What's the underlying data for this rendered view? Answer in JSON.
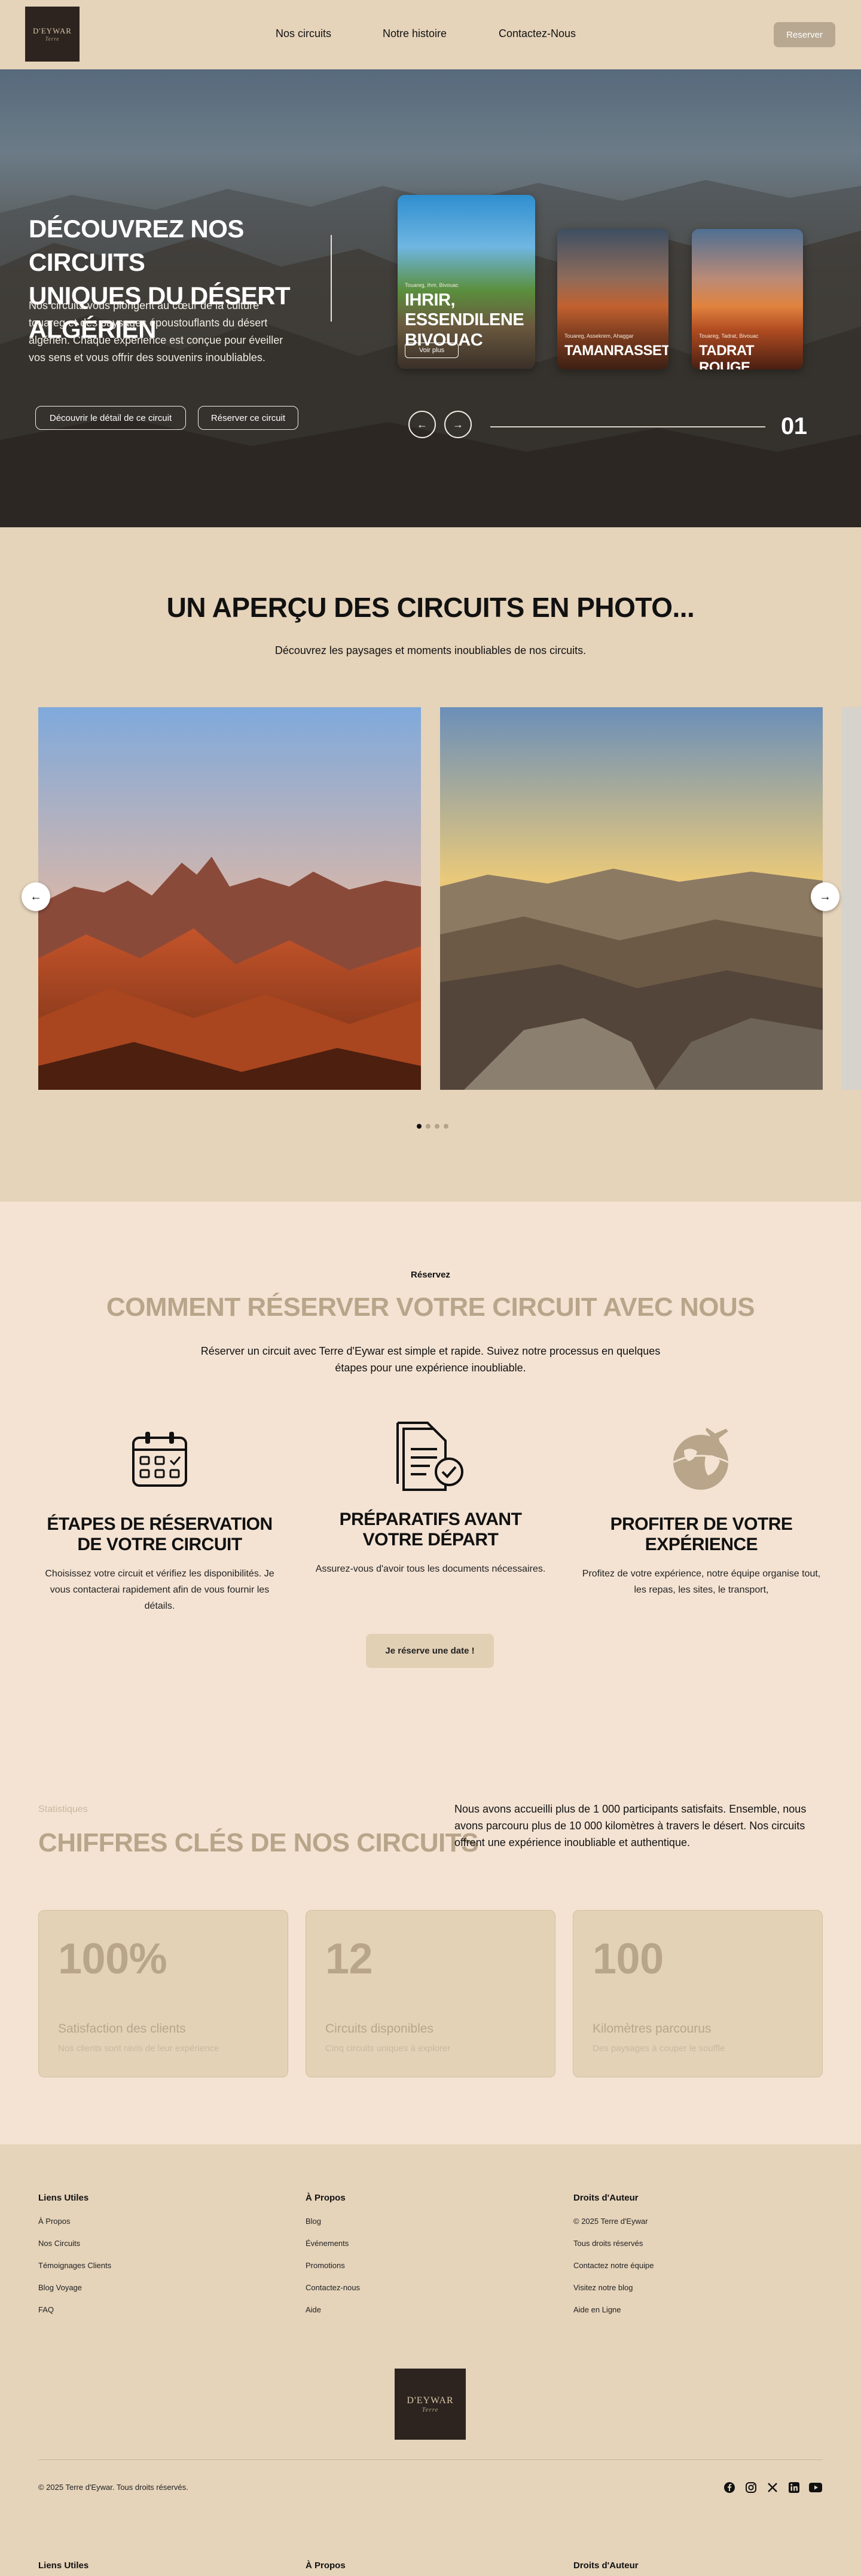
{
  "header": {
    "logo_text": "D'EYWAR",
    "logo_sub": "Terre",
    "nav": [
      "Nos circuits",
      "Notre histoire",
      "Contactez-Nous"
    ],
    "reserve_label": "Reserver"
  },
  "hero": {
    "title_line1": "DÉCOUVREZ NOS CIRCUITS",
    "title_line2": "UNIQUES DU DÉSERT ALGÉRIEN",
    "text": "Nos circuits vous plongent au cœur de la culture touareg et des paysages époustouflants du désert algérien. Chaque expérience est conçue pour éveiller vos sens et vous offrir des souvenirs inoubliables.",
    "btn_details": "Découvrir le détail de ce circuit",
    "btn_reserve": "Réserver ce circuit",
    "cards": [
      {
        "tag": "Touareg, Ihrir, Bivouac",
        "title_line1": "IHRIR, ESSENDILENE",
        "title_line2": "BIVOUAC",
        "button": "Voir plus"
      },
      {
        "tag": "Touareg, Assekrem, Ahaggar",
        "title_line1": "TAMANRASSET",
        "title_line2": ""
      },
      {
        "tag": "Touareg, Tadrat, Bivouac",
        "title_line1": "TADRAT ROUGE",
        "title_line2": ""
      }
    ],
    "slide_number": "01"
  },
  "gallery": {
    "title": "UN APERÇU DES CIRCUITS EN PHOTO...",
    "subtitle": "Découvrez les paysages et moments inoubliables de nos circuits.",
    "dots": 4,
    "active_dot": 0
  },
  "reserve": {
    "kicker": "Réservez",
    "title": "COMMENT RÉSERVER VOTRE CIRCUIT AVEC NOUS",
    "text_line1": "Réserver un circuit avec Terre d'Eywar est simple et rapide. Suivez notre processus en quelques",
    "text_line2": "étapes pour une expérience inoubliable.",
    "steps": [
      {
        "icon": "calendar-icon",
        "title": "ÉTAPES DE RÉSERVATION DE VOTRE CIRCUIT",
        "text": "Choisissez votre circuit et vérifiez les disponibilités. Je vous contacterai rapidement afin de vous fournir les détails."
      },
      {
        "icon": "document-check-icon",
        "title": "PRÉPARATIFS AVANT VOTRE DÉPART",
        "text": "Assurez-vous d'avoir tous les documents nécessaires."
      },
      {
        "icon": "globe-plane-icon",
        "title": "PROFITER DE VOTRE EXPÉRIENCE",
        "text": "Profitez de votre expérience, notre équipe organise tout, les repas, les sites, le transport,"
      }
    ],
    "cta": "Je réserve une date !"
  },
  "stats": {
    "kicker": "Statistiques",
    "title": "CHIFFRES CLÉS DE NOS CIRCUITS",
    "text": "Nous avons accueilli plus de 1 000 participants satisfaits. Ensemble, nous avons parcouru plus de 10 000 kilomètres à travers le désert. Nos circuits offrent une expérience inoubliable et authentique.",
    "cards": [
      {
        "value": "100%",
        "label": "Satisfaction des clients",
        "desc": "Nos clients sont ravis de leur expérience"
      },
      {
        "value": "12",
        "label": "Circuits disponibles",
        "desc": "Cinq circuits uniques à explorer"
      },
      {
        "value": "100",
        "label": "Kilomètres parcourus",
        "desc": "Des paysages à couper le souffle"
      }
    ]
  },
  "footer": {
    "columns": [
      {
        "title": "Liens Utiles",
        "links": [
          "À Propos",
          "Nos Circuits",
          "Témoignages Clients",
          "Blog Voyage",
          "FAQ"
        ]
      },
      {
        "title": "À Propos",
        "links": [
          "Blog",
          "Événements",
          "Promotions",
          "Contactez-nous",
          "Aide"
        ]
      },
      {
        "title": "Droits d'Auteur",
        "links": [
          "© 2025 Terre d'Eywar",
          "Tous droits réservés",
          "Contactez notre équipe",
          "Visitez notre blog",
          "Aide en Ligne"
        ]
      }
    ],
    "logo_text": "D'EYWAR",
    "logo_sub": "Terre",
    "copyright": "© 2025 Terre d'Eywar. Tous droits réservés.",
    "social": [
      "facebook-icon",
      "instagram-icon",
      "x-icon",
      "linkedin-icon",
      "youtube-icon"
    ],
    "repeat_titles": [
      "Liens Utiles",
      "À Propos",
      "Droits d'Auteur"
    ]
  }
}
